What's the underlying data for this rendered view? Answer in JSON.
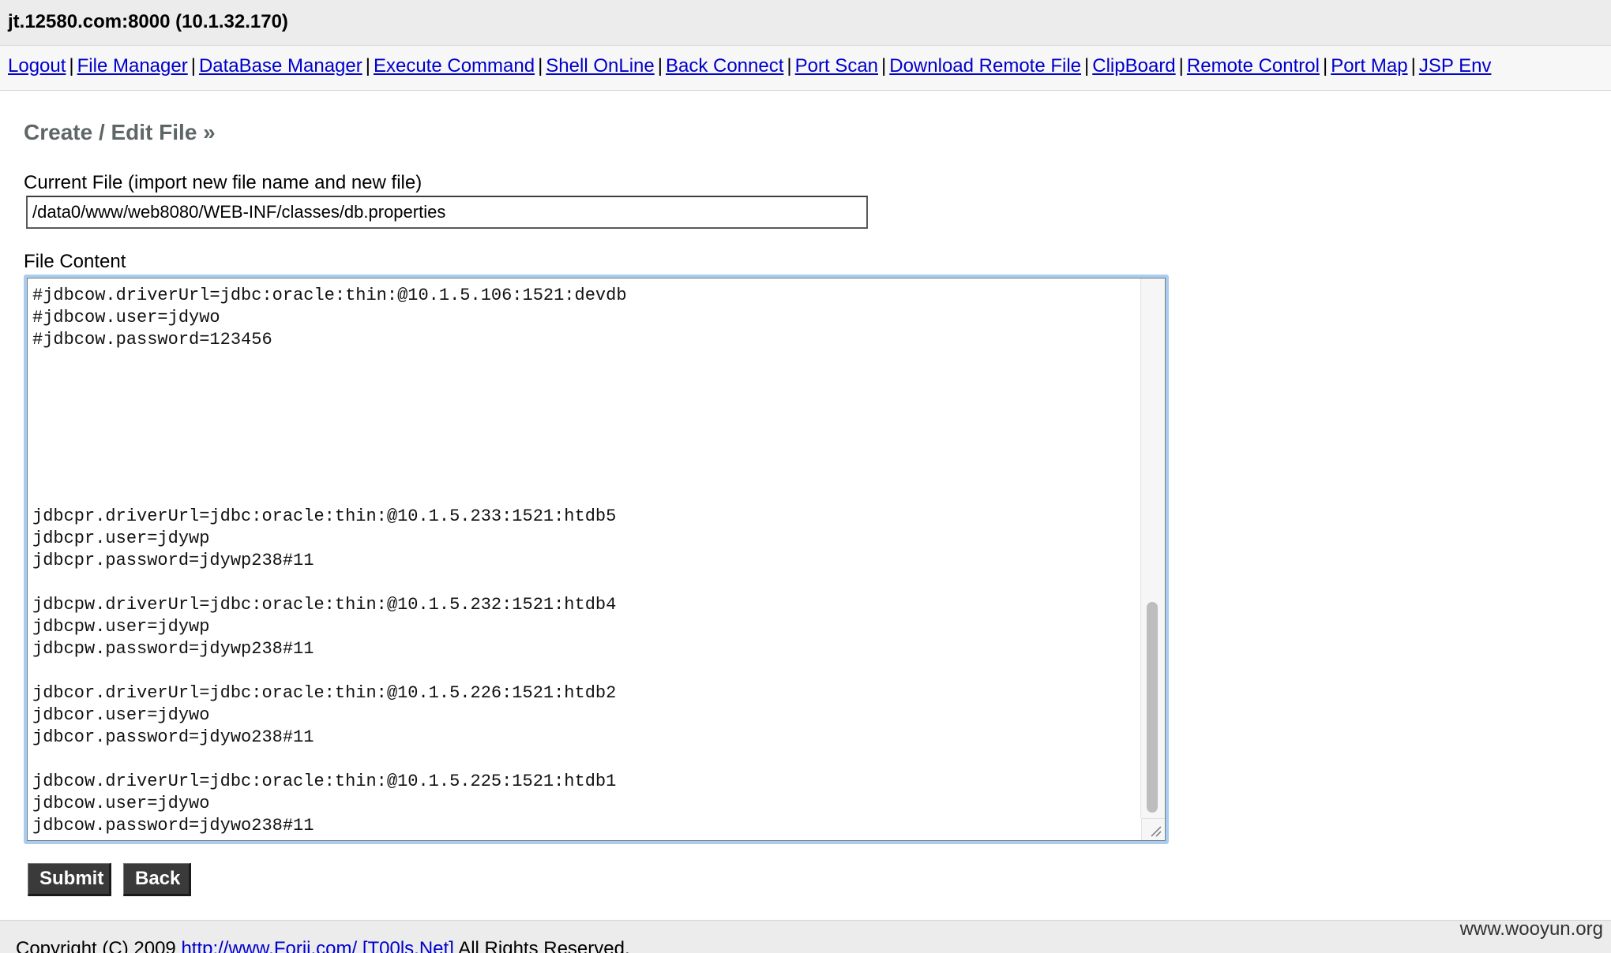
{
  "window": {
    "host_title": "jt.12580.com:8000 (10.1.32.170)"
  },
  "nav": {
    "separator": "|",
    "items": [
      {
        "label": "Logout"
      },
      {
        "label": "File Manager"
      },
      {
        "label": "DataBase Manager"
      },
      {
        "label": "Execute Command"
      },
      {
        "label": "Shell OnLine"
      },
      {
        "label": "Back Connect"
      },
      {
        "label": "Port Scan"
      },
      {
        "label": "Download Remote File"
      },
      {
        "label": "ClipBoard"
      },
      {
        "label": "Remote Control"
      },
      {
        "label": "Port Map"
      },
      {
        "label": "JSP Env"
      }
    ]
  },
  "editor": {
    "section_title": "Create / Edit File »",
    "current_file_label": "Current File (import new file name and new file)",
    "current_file_value": "/data0/www/web8080/WEB-INF/classes/db.properties",
    "content_label": "File Content",
    "content": "#jdbcow.driverUrl=jdbc:oracle:thin:@10.1.5.106:1521:devdb\n#jdbcow.user=jdywo\n#jdbcow.password=123456\n\n\n\n\n\n\n\njdbcpr.driverUrl=jdbc:oracle:thin:@10.1.5.233:1521:htdb5\njdbcpr.user=jdywp\njdbcpr.password=jdywp238#11\n\njdbcpw.driverUrl=jdbc:oracle:thin:@10.1.5.232:1521:htdb4\njdbcpw.user=jdywp\njdbcpw.password=jdywp238#11\n\njdbcor.driverUrl=jdbc:oracle:thin:@10.1.5.226:1521:htdb2\njdbcor.user=jdywo\njdbcor.password=jdywo238#11\n\njdbcow.driverUrl=jdbc:oracle:thin:@10.1.5.225:1521:htdb1\njdbcow.user=jdywo\njdbcow.password=jdywo238#11",
    "scroll": {
      "thumb_start": 0.6,
      "thumb_end": 0.99
    },
    "submit_label": "Submit",
    "back_label": "Back"
  },
  "footer": {
    "prefix": "Copyright (C) 2009",
    "link1": "http://www.Forjj.com/",
    "link2": "[T00ls.Net]",
    "suffix": "All Rights Reserved."
  },
  "watermark": "www.wooyun.org",
  "colors": {
    "link": "#0000cc",
    "focus_ring": "#a9cdf1",
    "button_bg": "#3a3a3a",
    "title_gray": "#5f6668"
  }
}
